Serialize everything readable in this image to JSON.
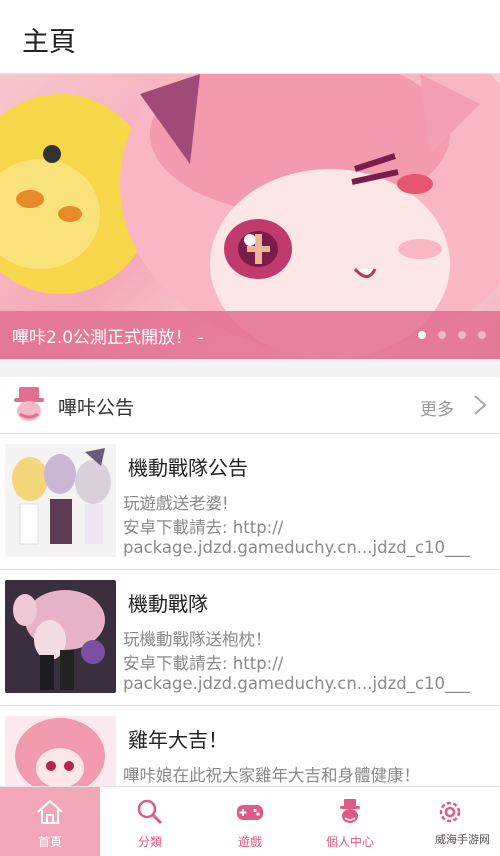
{
  "header": {
    "title": "主頁"
  },
  "banner": {
    "caption": "嗶咔2.0公測正式開放！ -",
    "dots": 4,
    "active_dot": 0
  },
  "section": {
    "title": "嗶咔公告",
    "more_label": "更多"
  },
  "items": [
    {
      "title": "機動戰隊公告",
      "lines": [
        "玩遊戲送老婆!",
        "安卓下載請去: http://",
        "package.jdzd.gameduchy.cn...jdzd_c10___"
      ]
    },
    {
      "title": "機動戰隊",
      "lines": [
        "玩機動戰隊送枹枕！",
        "安卓下載請去: http://",
        "package.jdzd.gameduchy.cn...jdzd_c10___"
      ]
    },
    {
      "title": "雞年大吉！",
      "lines": [
        "嗶咔娘在此祝大家雞年大吉和身體健康！"
      ]
    }
  ],
  "tabs": [
    {
      "label": "首頁",
      "icon": "home-icon",
      "active": true
    },
    {
      "label": "分類",
      "icon": "search-icon",
      "active": false
    },
    {
      "label": "遊戲",
      "icon": "gamepad-icon",
      "active": false
    },
    {
      "label": "個人中心",
      "icon": "user-icon",
      "active": false
    },
    {
      "label": "設定",
      "icon": "gear-icon",
      "active": false
    }
  ],
  "watermark": "威海手游网",
  "colors": {
    "accent": "#e05a87",
    "tab_active_bg": "#f2a7b8",
    "banner_bar": "#e26e91"
  }
}
